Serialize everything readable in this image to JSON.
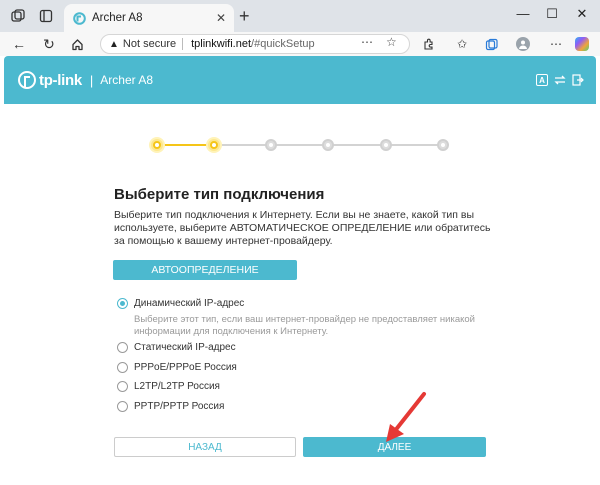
{
  "browser": {
    "tab_title": "Archer A8",
    "security_label": "Not secure",
    "url_host": "tplinkwifi.net",
    "url_path": "/#quickSetup"
  },
  "router": {
    "brand": "tp-link",
    "model": "Archer A8",
    "header_icons": [
      "language-icon",
      "swap-icon",
      "logout-icon"
    ]
  },
  "stepper": {
    "total_steps": 6,
    "current_step": 2
  },
  "setup": {
    "title": "Выберите тип подключения",
    "description": "Выберите тип подключения к Интернету. Если вы не знаете, какой тип вы используете, выберите АВТОМАТИЧЕСКОЕ ОПРЕДЕЛЕНИЕ или обратитесь за помощью к вашему интернет-провайдеру.",
    "auto_button": "АВТООПРЕДЕЛЕНИЕ",
    "options": [
      {
        "label": "Динамический IP-адрес",
        "checked": true
      },
      {
        "label": "Статический IP-адрес",
        "checked": false
      },
      {
        "label": "PPPoE/PPPoE Россия",
        "checked": false
      },
      {
        "label": "L2TP/L2TP Россия",
        "checked": false
      },
      {
        "label": "PPTP/PPTP Россия",
        "checked": false
      }
    ],
    "option_hint": "Выберите этот тип, если ваш интернет-провайдер не предоставляет никакой информации для подключения к Интернету.",
    "back_button": "НАЗАД",
    "next_button": "ДАЛЕЕ"
  },
  "colors": {
    "accent": "#4cb9cf",
    "step_active": "#f5c518",
    "arrow": "#e53935"
  }
}
